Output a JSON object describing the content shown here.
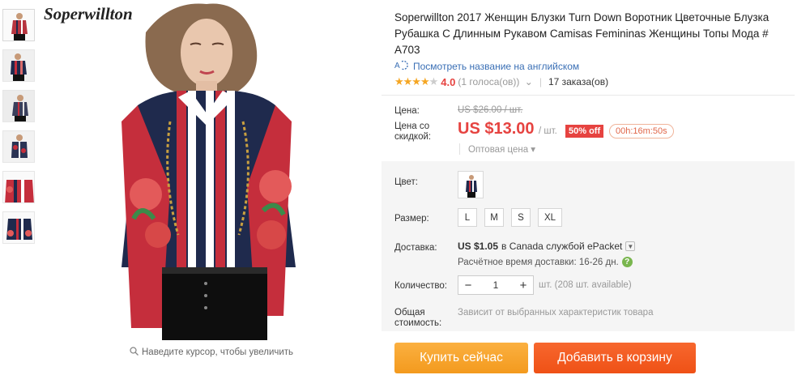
{
  "brand": "Soperwillton",
  "thumbnails": [
    {
      "label": "thumb-1"
    },
    {
      "label": "thumb-2"
    },
    {
      "label": "thumb-3"
    },
    {
      "label": "thumb-4"
    },
    {
      "label": "thumb-5"
    },
    {
      "label": "thumb-6"
    }
  ],
  "zoom_hint": "Наведите курсор, чтобы увеличить",
  "product": {
    "title": "Soperwillton 2017 Женщин Блузки Turn Down Воротник Цветочные Блузка Рубашка С Длинным Рукавом Camisas Femininas Женщины Топы Мода # A703",
    "translate_link": "Посмотреть название на английском",
    "rating": "4.0",
    "votes": "(1 голоса(ов))",
    "orders": "17 заказа(ов)"
  },
  "pricing": {
    "price_label": "Цена:",
    "old_price": "US $26.00 / шт.",
    "discount_label_1": "Цена со",
    "discount_label_2": "скидкой:",
    "new_price": "US $13.00",
    "per_unit": "/ шт.",
    "discount_badge": "50% off",
    "timer": "00h:16m:50s",
    "wholesale": "Оптовая цена ▾"
  },
  "options": {
    "color_label": "Цвет:",
    "size_label": "Размер:",
    "sizes": [
      "L",
      "M",
      "S",
      "XL"
    ]
  },
  "shipping": {
    "label": "Доставка:",
    "price": "US $1.05",
    "dest": "в Canada службой ePacket",
    "time": "Расчётное время доставки: 16-26 дн."
  },
  "quantity": {
    "label": "Количество:",
    "value": "1",
    "available": "шт. (208 шт. available)"
  },
  "total": {
    "label_1": "Общая",
    "label_2": "стоимость:",
    "note": "Зависит от выбранных характеристик товара"
  },
  "buttons": {
    "buy": "Купить сейчас",
    "cart": "Добавить в корзину"
  },
  "colors": {
    "price_red": "#e64340",
    "buy_orange": "#f5a623",
    "cart_orange": "#ef5116",
    "link_blue": "#3a6fb5"
  }
}
